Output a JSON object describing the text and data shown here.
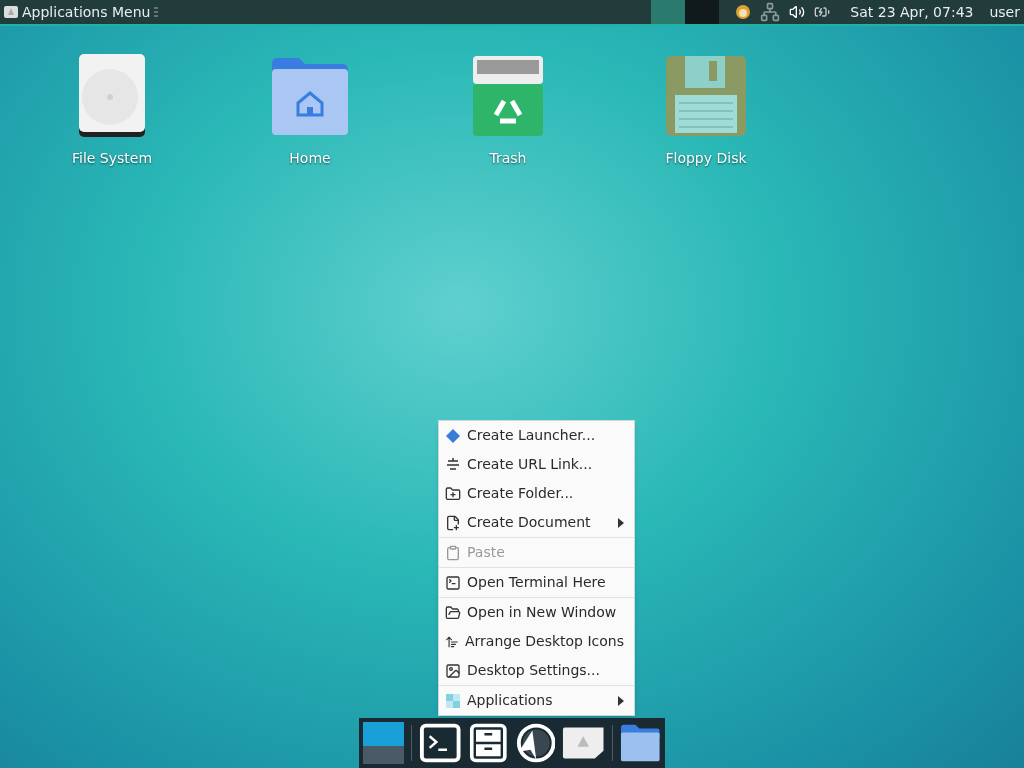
{
  "panel": {
    "app_menu_label": "Applications Menu",
    "clock": "Sat 23 Apr, 07:43",
    "user": "user"
  },
  "desktop_icons": [
    {
      "label": "File System",
      "kind": "drive"
    },
    {
      "label": "Home",
      "kind": "home"
    },
    {
      "label": "Trash",
      "kind": "trash"
    },
    {
      "label": "Floppy Disk",
      "kind": "floppy"
    }
  ],
  "context_menu": {
    "groups": [
      [
        {
          "label": "Create Launcher...",
          "kind": "launcher",
          "disabled": false,
          "submenu": false
        },
        {
          "label": "Create URL Link...",
          "kind": "link",
          "disabled": false,
          "submenu": false
        },
        {
          "label": "Create Folder...",
          "kind": "folder",
          "disabled": false,
          "submenu": false
        },
        {
          "label": "Create Document",
          "kind": "document",
          "disabled": false,
          "submenu": true
        }
      ],
      [
        {
          "label": "Paste",
          "kind": "paste",
          "disabled": true,
          "submenu": false
        }
      ],
      [
        {
          "label": "Open Terminal Here",
          "kind": "terminal",
          "disabled": false,
          "submenu": false
        }
      ],
      [
        {
          "label": "Open in New Window",
          "kind": "open",
          "disabled": false,
          "submenu": false
        },
        {
          "label": "Arrange Desktop Icons",
          "kind": "arrange",
          "disabled": false,
          "submenu": false
        },
        {
          "label": "Desktop Settings...",
          "kind": "settings",
          "disabled": false,
          "submenu": false
        }
      ],
      [
        {
          "label": "Applications",
          "kind": "apps",
          "disabled": false,
          "submenu": true
        }
      ]
    ]
  }
}
